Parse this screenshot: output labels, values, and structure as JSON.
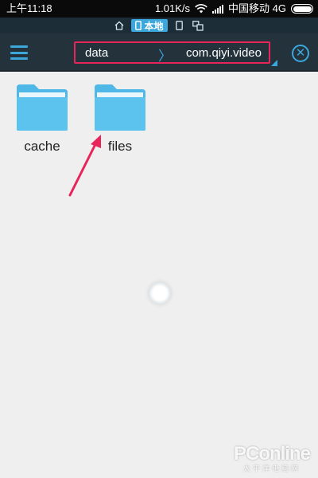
{
  "status_bar": {
    "time": "上午11:18",
    "speed": "1.01K/s",
    "carrier": "中国移动 4G",
    "icons": [
      "wifi-icon",
      "signal-icon",
      "battery-icon"
    ]
  },
  "storage_tabs": {
    "local_label": "本地",
    "icons": [
      "home-icon",
      "phone-icon",
      "device-icon",
      "remote-device-icon"
    ],
    "active": "local"
  },
  "toolbar": {
    "menu_icon": "hamburger-icon",
    "breadcrumb": {
      "root": "data",
      "separator": "〉",
      "current": "com.qiyi.video"
    },
    "close_icon": "close-circle-icon"
  },
  "files": [
    {
      "name": "cache",
      "type": "folder",
      "icon": "folder-icon"
    },
    {
      "name": "files",
      "type": "folder",
      "icon": "folder-icon"
    }
  ],
  "annotation": {
    "type": "arrow",
    "target": "files",
    "color": "#e8245a"
  },
  "loading": {
    "icon": "loading-spinner-icon"
  },
  "watermark": {
    "brand": "PConline",
    "subtitle": "太平洋电脑网"
  },
  "colors": {
    "accent": "#3ba7dc",
    "toolbar_bg": "#24323c",
    "status_bg": "#0a0a0a",
    "highlight": "#e8245a",
    "folder": "#5bc3ee",
    "content_bg": "#efefef"
  }
}
